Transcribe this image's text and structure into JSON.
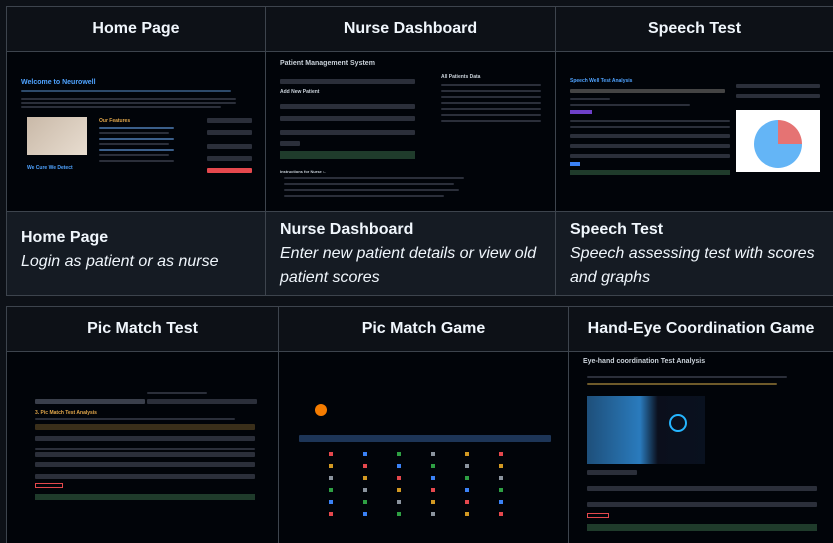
{
  "row1": {
    "headers": [
      "Home Page",
      "Nurse Dashboard",
      "Speech Test"
    ],
    "descriptions": [
      {
        "title": "Home Page",
        "subtitle": "Login as patient or as nurse"
      },
      {
        "title": "Nurse Dashboard",
        "subtitle": "Enter new patient details or view old patient scores"
      },
      {
        "title": "Speech Test",
        "subtitle": "Speech assessing test with scores and graphs"
      }
    ]
  },
  "row2": {
    "headers": [
      "Pic Match Test",
      "Pic Match Game",
      "Hand-Eye Coordination Game"
    ]
  },
  "screens": {
    "home": {
      "welcome": "Welcome to Neurowell",
      "features": "Our Features",
      "cure": "We Cure We Detect"
    },
    "nurse": {
      "title": "Patient Management System",
      "add": "Add New Patient",
      "all": "All Patients Data",
      "instructions": "Instructions for Nurse :-"
    },
    "speech": {
      "title": "Speech Well Test Analysis"
    },
    "picmatch": {
      "title": "3. Pic Match Test Analysis"
    },
    "handeye": {
      "title": "Eye-hand coordination Test Analysis"
    }
  },
  "colors": {
    "accent_blue": "#4fa3ff",
    "success_green": "#1f3b2b",
    "danger_red": "#e5484d",
    "border": "#3d444d"
  }
}
